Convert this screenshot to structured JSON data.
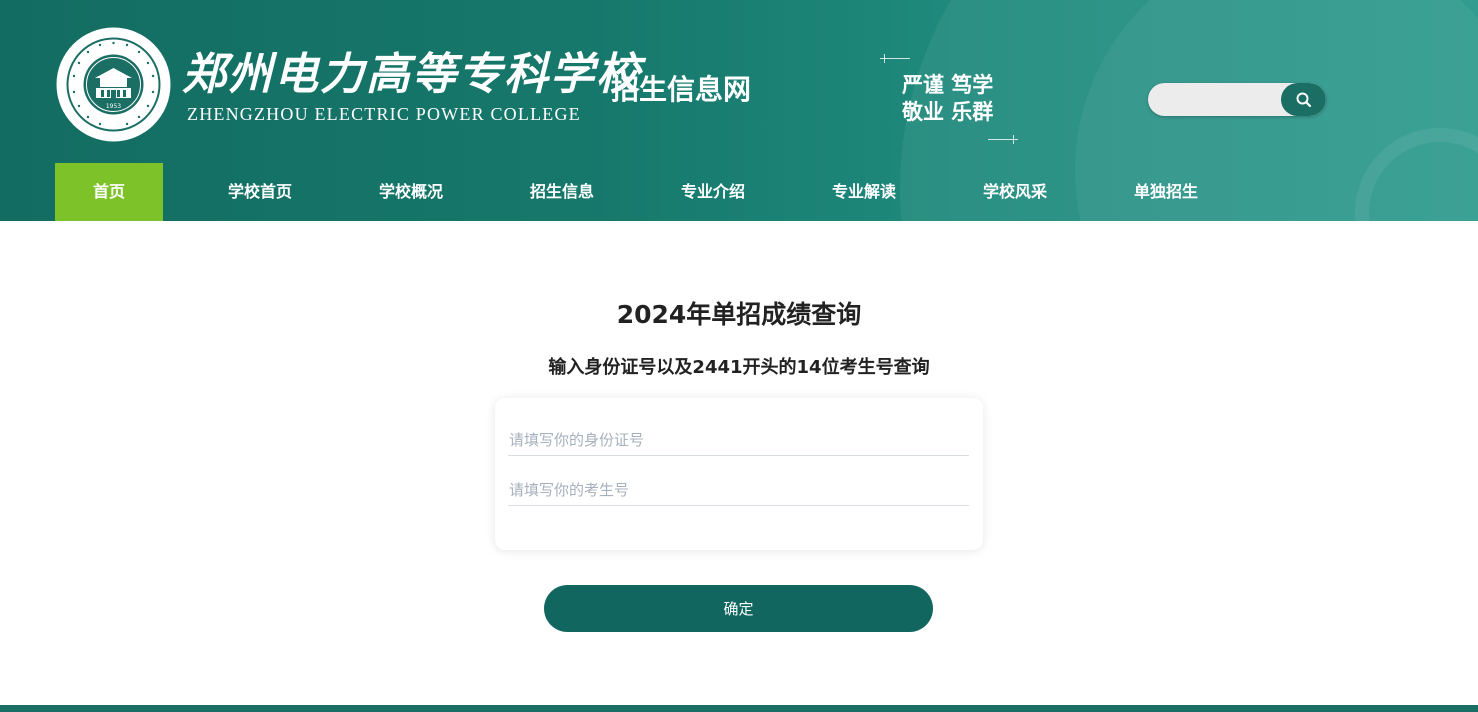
{
  "header": {
    "school_name_cn": "郑州电力高等专科学校",
    "school_name_en": "ZHENGZHOU ELECTRIC POWER COLLEGE",
    "site_name": "招生信息网",
    "motto_line1": "严谨 笃学",
    "motto_line2": "敬业 乐群",
    "logo": {
      "ring_text": "郑州电力高等专科学校 ZHENGZHOU ELECTRIC POWER COLLEGE",
      "year": "1953"
    },
    "search": {
      "value": "",
      "placeholder": "",
      "icon": "search-icon"
    }
  },
  "nav": {
    "items": [
      {
        "label": "首页",
        "active": true
      },
      {
        "label": "学校首页",
        "active": false
      },
      {
        "label": "学校概况",
        "active": false
      },
      {
        "label": "招生信息",
        "active": false
      },
      {
        "label": "专业介绍",
        "active": false
      },
      {
        "label": "专业解读",
        "active": false
      },
      {
        "label": "学校风采",
        "active": false
      },
      {
        "label": "单独招生",
        "active": false
      }
    ]
  },
  "main": {
    "title": "2024年单招成绩查询",
    "subtitle": "输入身份证号以及2441开头的14位考生号查询",
    "form": {
      "id_placeholder": "请填写你的身份证号",
      "id_value": "",
      "exam_placeholder": "请填写你的考生号",
      "exam_value": ""
    },
    "submit_label": "确定"
  },
  "colors": {
    "header_primary": "#136c61",
    "nav_active": "#7cc228",
    "button": "#11675f"
  }
}
